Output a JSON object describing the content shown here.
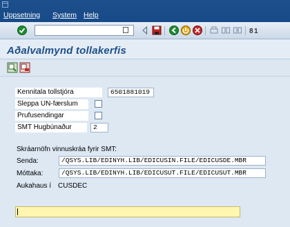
{
  "menubar": {
    "items": [
      "Uppsetning",
      "System",
      "Help"
    ]
  },
  "toolbar": {
    "command_field_value": "",
    "icons": [
      "enter-icon",
      "dropdown-icon",
      "back-arrow-icon",
      "save-icon",
      "back-icon",
      "exit-icon",
      "cancel-icon",
      "print-icon",
      "find-icon",
      "find-next-icon",
      "first-page-icon"
    ]
  },
  "title": "Aðalvalmynd tollakerfis",
  "form": {
    "kennitala_label": "Kennitala tollstjóra",
    "kennitala_value": "6501881019",
    "sleppa_label": "Sleppa UN-færslum",
    "sleppa_checked": false,
    "prufu_label": "Prufusendingar",
    "prufu_checked": false,
    "smt_label": "SMT Hugbúnaður",
    "smt_value": "2",
    "files_heading": "Skráarnöfn vinnuskráa fyrir SMT:",
    "senda_label": "Senda:",
    "senda_value": "/QSYS.LIB/EDINYH.LIB/EDICUSIN.FILE/EDICUSDE.MBR",
    "mottaka_label": "Móttaka:",
    "mottaka_value": "/QSYS.LIB/EDINYH.LIB/EDICUSUT.FILE/EDICUSUT.MBR",
    "aukahaus_label": "Aukahaus í",
    "aukahaus_value": "CUSDEC",
    "input_value": ""
  },
  "colors": {
    "menubar": "#1d4f8c",
    "title": "#1f4f86",
    "content_bg": "#dde8f3",
    "active_input": "#fff6b0"
  }
}
